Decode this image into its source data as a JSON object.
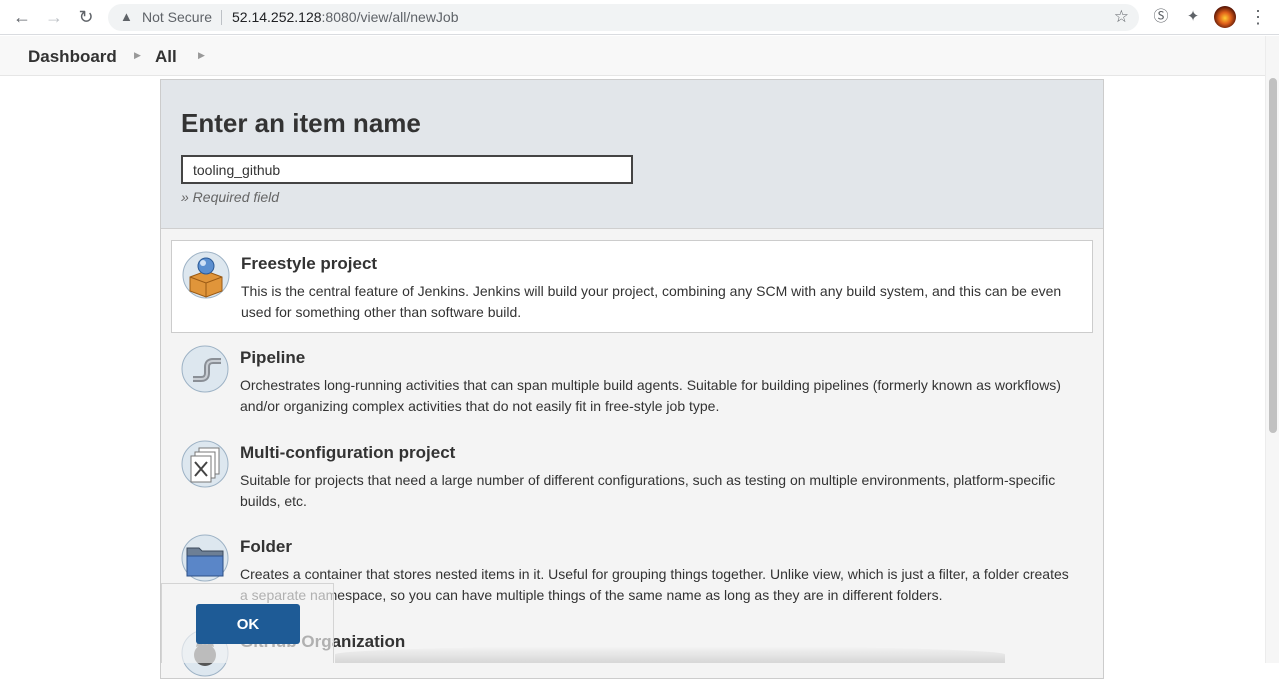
{
  "browser": {
    "security_label": "Not Secure",
    "url_host": "52.14.252.128",
    "url_rest": ":8080/view/all/newJob"
  },
  "breadcrumb": {
    "items": [
      "Dashboard",
      "All"
    ]
  },
  "form": {
    "title": "Enter an item name",
    "item_name_value": "tooling_github",
    "required_hint": "» Required field"
  },
  "job_types": [
    {
      "title": "Freestyle project",
      "description": "This is the central feature of Jenkins. Jenkins will build your project, combining any SCM with any build system, and this can be even used for something other than software build.",
      "icon": "freestyle-project-icon",
      "selected": true
    },
    {
      "title": "Pipeline",
      "description": "Orchestrates long-running activities that can span multiple build agents. Suitable for building pipelines (formerly known as workflows) and/or organizing complex activities that do not easily fit in free-style job type.",
      "icon": "pipeline-icon",
      "selected": false
    },
    {
      "title": "Multi-configuration project",
      "description": "Suitable for projects that need a large number of different configurations, such as testing on multiple environments, platform-specific builds, etc.",
      "icon": "multi-configuration-icon",
      "selected": false
    },
    {
      "title": "Folder",
      "description": "Creates a container that stores nested items in it. Useful for grouping things together. Unlike view, which is just a filter, a folder creates a separate namespace, so you can have multiple things of the same name as long as they are in different folders.",
      "icon": "folder-icon",
      "selected": false
    },
    {
      "title": "GitHub Organization",
      "description": "",
      "icon": "github-organization-icon",
      "selected": false
    }
  ],
  "actions": {
    "ok_label": "OK"
  },
  "colors": {
    "ok_button": "#1e5b96",
    "header_bg": "#e2e6ea",
    "panel_bg": "#f4f4f4"
  }
}
